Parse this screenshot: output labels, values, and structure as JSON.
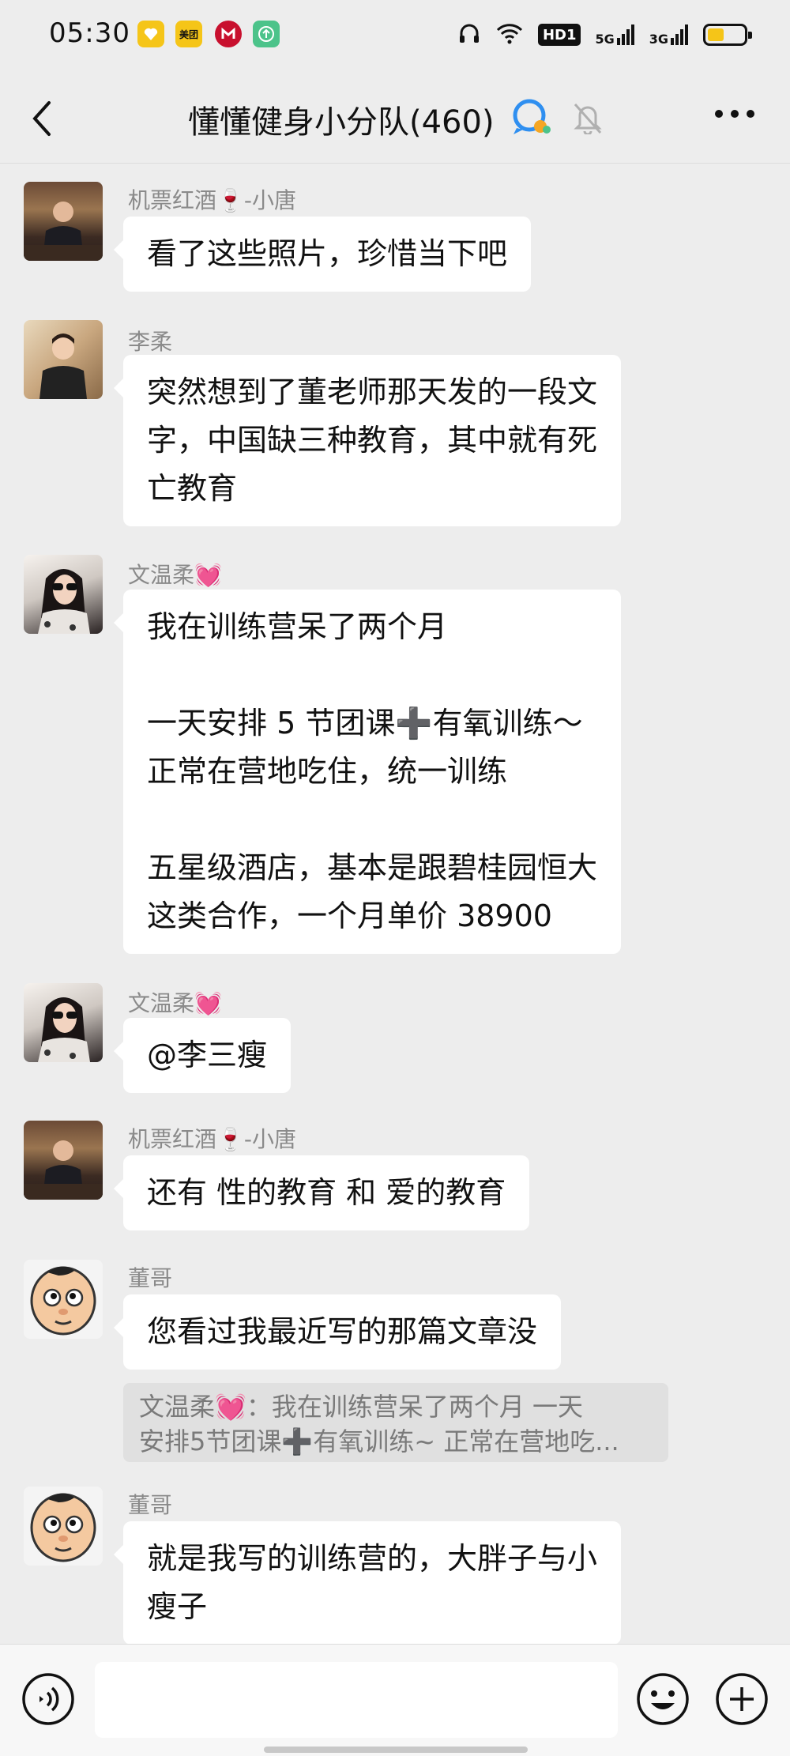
{
  "status_bar": {
    "time": "05:30",
    "app_icons": [
      {
        "name": "favorite-app-icon",
        "label": "",
        "color": "#f5c518"
      },
      {
        "name": "meituan-app-icon",
        "label": "美团",
        "color": "#f5c518"
      },
      {
        "name": "bank-app-icon",
        "label": "",
        "color": "#c8102e"
      },
      {
        "name": "upload-app-icon",
        "label": "",
        "color": "#4cc38a"
      }
    ],
    "hd_label": "HD1",
    "net1": "5G",
    "net2": "3G"
  },
  "header": {
    "title": "懂懂健身小分队(460)"
  },
  "messages": [
    {
      "sender": "机票红酒🍷-小唐",
      "text": "看了这些照片，珍惜当下吧"
    },
    {
      "sender": "李柔",
      "text": "突然想到了董老师那天发的一段文\n字，中国缺三种教育，其中就有死\n亡教育"
    },
    {
      "sender": "文温柔💓",
      "text": "我在训练营呆了两个月\n\n一天安排 5 节团课➕有氧训练～\n正常在营地吃住，统一训练\n\n五星级酒店，基本是跟碧桂园恒大\n这类合作，一个月单价 38900"
    },
    {
      "sender": "文温柔💓",
      "text": "@李三瘦"
    },
    {
      "sender": "机票红酒🍷-小唐",
      "text": "还有 性的教育 和 爱的教育"
    },
    {
      "sender": "董哥",
      "text": "您看过我最近写的那篇文章没",
      "quote_line1": "文温柔💓：我在训练营呆了两个月  一天",
      "quote_line2": "安排5节团课➕有氧训练~ 正常在营地吃..."
    },
    {
      "sender": "董哥",
      "text": "就是我写的训练营的，大胖子与小\n瘦子"
    }
  ],
  "input": {
    "placeholder": ""
  },
  "colors": {
    "background": "#ededed",
    "bubble": "#ffffff",
    "sender_text": "#8a8a8a"
  }
}
